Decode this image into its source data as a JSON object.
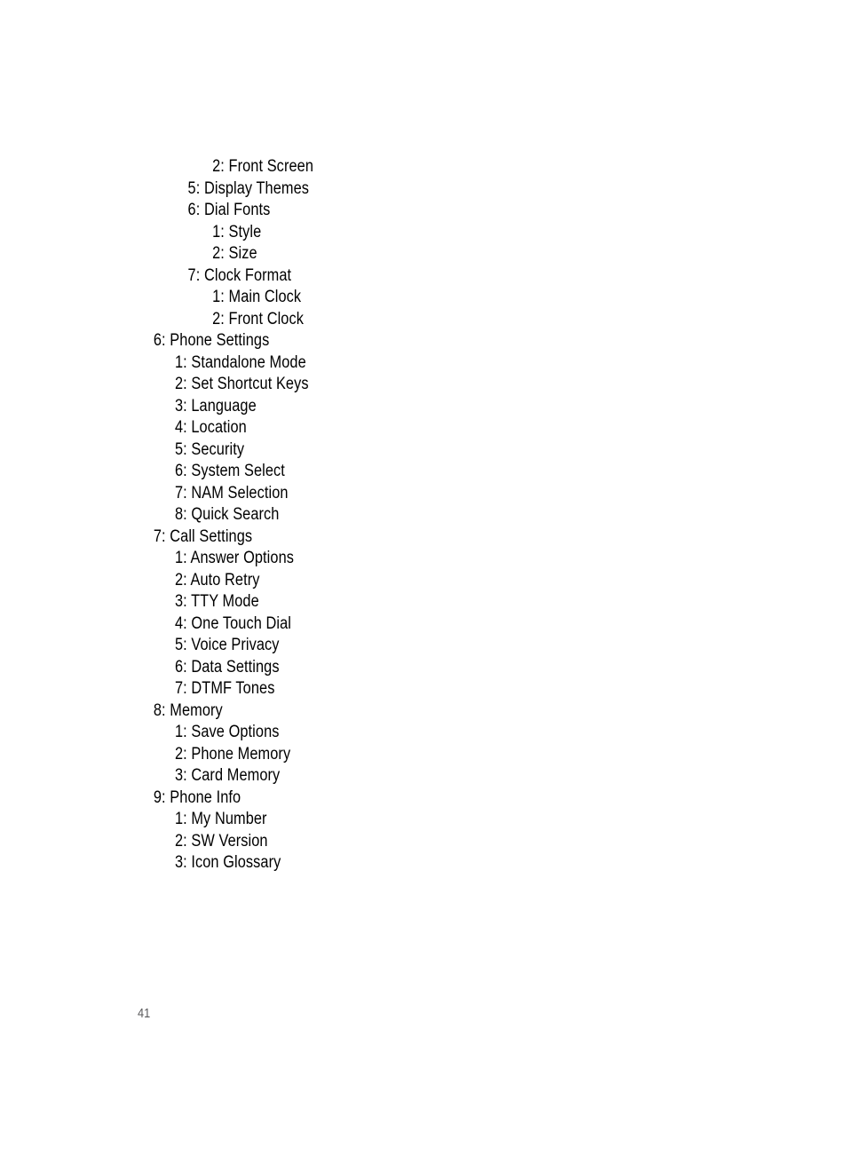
{
  "page": {
    "folio": "41",
    "background_color": "#ffffff",
    "text_color": "#000000",
    "folio_color": "#58585a"
  },
  "outline": {
    "rows": [
      {
        "label": "2: Front Screen",
        "level": 4
      },
      {
        "label": "5: Display Themes",
        "level": 3
      },
      {
        "label": "6: Dial Fonts",
        "level": 3
      },
      {
        "label": "1: Style",
        "level": 4
      },
      {
        "label": "2: Size",
        "level": 4
      },
      {
        "label": "7: Clock Format",
        "level": 3
      },
      {
        "label": "1: Main Clock",
        "level": 4
      },
      {
        "label": "2: Front Clock",
        "level": 4
      },
      {
        "label": "6: Phone Settings",
        "level": 1
      },
      {
        "label": "1: Standalone Mode",
        "level": 2
      },
      {
        "label": "2: Set Shortcut Keys",
        "level": 2
      },
      {
        "label": "3: Language",
        "level": 2
      },
      {
        "label": "4: Location",
        "level": 2
      },
      {
        "label": "5: Security",
        "level": 2
      },
      {
        "label": "6: System Select",
        "level": 2
      },
      {
        "label": "7: NAM Selection",
        "level": 2
      },
      {
        "label": "8: Quick Search",
        "level": 2
      },
      {
        "label": "7: Call Settings",
        "level": 1
      },
      {
        "label": "1: Answer Options",
        "level": 2
      },
      {
        "label": "2: Auto Retry",
        "level": 2
      },
      {
        "label": "3: TTY Mode",
        "level": 2
      },
      {
        "label": "4: One Touch Dial",
        "level": 2
      },
      {
        "label": "5: Voice Privacy",
        "level": 2
      },
      {
        "label": "6: Data Settings",
        "level": 2
      },
      {
        "label": "7: DTMF Tones",
        "level": 2
      },
      {
        "label": "8: Memory",
        "level": 1
      },
      {
        "label": "1: Save Options",
        "level": 2
      },
      {
        "label": "2: Phone Memory",
        "level": 2
      },
      {
        "label": "3: Card Memory",
        "level": 2
      },
      {
        "label": "9: Phone Info",
        "level": 1
      },
      {
        "label": "1: My Number",
        "level": 2
      },
      {
        "label": "2: SW Version",
        "level": 2
      },
      {
        "label": "3: Icon Glossary",
        "level": 2
      }
    ]
  }
}
